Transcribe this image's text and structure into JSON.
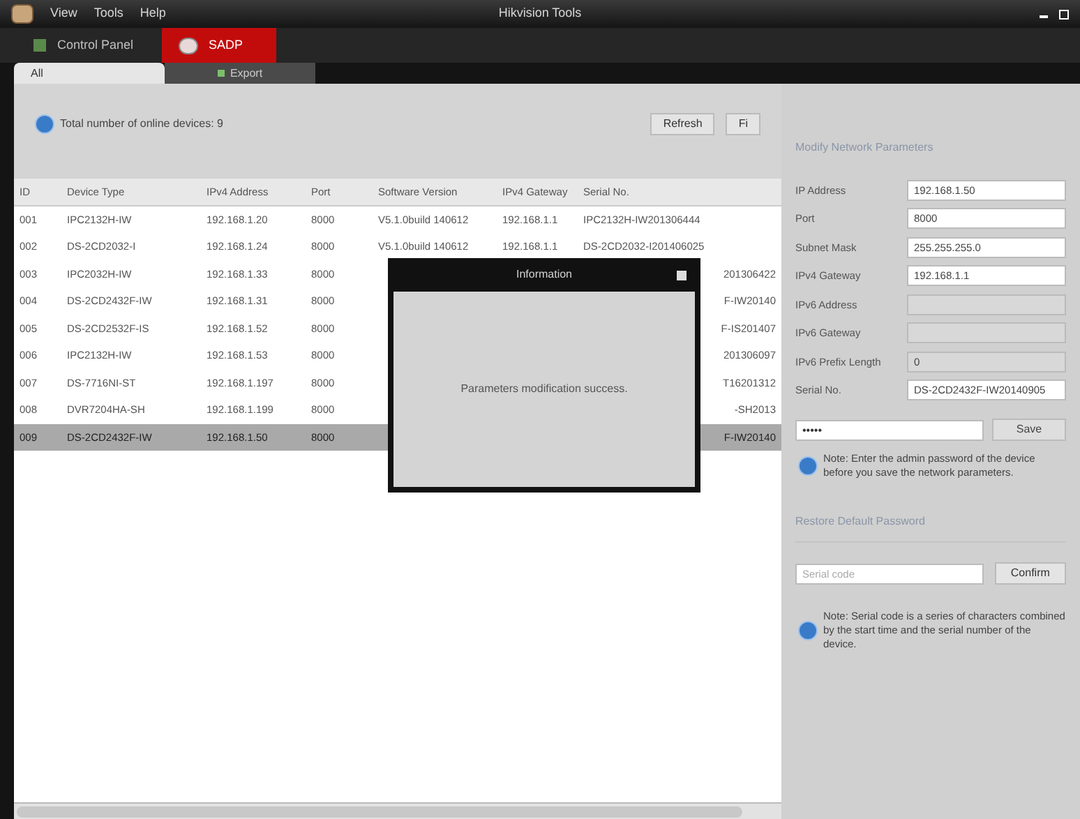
{
  "window": {
    "title": "Hikvision Tools",
    "menu": [
      "View",
      "Tools",
      "Help"
    ]
  },
  "main_tabs": [
    {
      "label": "Control Panel",
      "selected": false
    },
    {
      "label": "SADP",
      "selected": true
    }
  ],
  "sub_tabs": [
    {
      "label": "All",
      "selected": true
    },
    {
      "label": "Export",
      "selected": false
    }
  ],
  "device_count": "Total number of online devices: 9",
  "toolbar": {
    "refresh": "Refresh",
    "filter": "Fi"
  },
  "table": {
    "columns": [
      "ID",
      "Device Type",
      "IPv4 Address",
      "Port",
      "Software Version",
      "IPv4 Gateway",
      "Serial No."
    ],
    "rows": [
      {
        "id": "001",
        "type": "IPC2132H-IW",
        "ip": "192.168.1.20",
        "port": "8000",
        "version": "V5.1.0build 140612",
        "gateway": "192.168.1.1",
        "serial": "IPC2132H-IW201306444",
        "selected": false
      },
      {
        "id": "002",
        "type": "DS-2CD2032-I",
        "ip": "192.168.1.24",
        "port": "8000",
        "version": "V5.1.0build 140612",
        "gateway": "192.168.1.1",
        "serial": "DS-2CD2032-I201406025",
        "selected": false
      },
      {
        "id": "003",
        "type": "IPC2032H-IW",
        "ip": "192.168.1.33",
        "port": "8000",
        "serial": "201306422",
        "selected": false
      },
      {
        "id": "004",
        "type": "DS-2CD2432F-IW",
        "ip": "192.168.1.31",
        "port": "8000",
        "serial": "F-IW20140",
        "selected": false
      },
      {
        "id": "005",
        "type": "DS-2CD2532F-IS",
        "ip": "192.168.1.52",
        "port": "8000",
        "serial": "F-IS201407",
        "selected": false
      },
      {
        "id": "006",
        "type": "IPC2132H-IW",
        "ip": "192.168.1.53",
        "port": "8000",
        "serial": "201306097",
        "selected": false
      },
      {
        "id": "007",
        "type": "DS-7716NI-ST",
        "ip": "192.168.1.197",
        "port": "8000",
        "serial": "T16201312",
        "selected": false
      },
      {
        "id": "008",
        "type": "DVR7204HA-SH",
        "ip": "192.168.1.199",
        "port": "8000",
        "serial": "-SH2013",
        "selected": false
      },
      {
        "id": "009",
        "type": "DS-2CD2432F-IW",
        "ip": "192.168.1.50",
        "port": "8000",
        "serial": "F-IW20140",
        "selected": true
      }
    ]
  },
  "dialog": {
    "title": "Information",
    "message": "Parameters modification success."
  },
  "modify": {
    "title": "Modify Network Parameters",
    "fields": [
      {
        "label": "IP Address",
        "value": "192.168.1.50",
        "disabled": false
      },
      {
        "label": "Port",
        "value": "8000",
        "disabled": false
      },
      {
        "label": "Subnet Mask",
        "value": "255.255.255.0",
        "disabled": false
      },
      {
        "label": "IPv4 Gateway",
        "value": "192.168.1.1",
        "disabled": false
      },
      {
        "label": "IPv6 Address",
        "disabled": true
      },
      {
        "label": "IPv6 Gateway",
        "disabled": true
      },
      {
        "label": "IPv6 Prefix Length",
        "value": "0",
        "disabled": true
      },
      {
        "label": "Serial No.",
        "value": "DS-2CD2432F-IW20140905",
        "disabled": false
      }
    ],
    "password": "•••••",
    "save": "Save",
    "note": "Note: Enter the admin password of the device before you save the network parameters."
  },
  "restore": {
    "title": "Restore Default Password",
    "placeholder": "Serial code",
    "confirm": "Confirm",
    "note": "Note: Serial code is a series of characters combined by the start time and the serial number of the device."
  }
}
